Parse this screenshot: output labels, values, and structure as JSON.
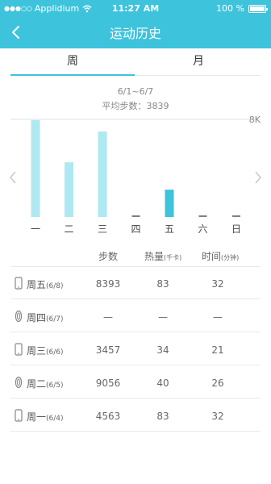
{
  "status": {
    "carrier": "Applidium",
    "time": "11:27 AM",
    "battery": "100 %"
  },
  "nav": {
    "title": "运动历史"
  },
  "tabs": [
    {
      "label": "周",
      "active": true
    },
    {
      "label": "月",
      "active": false
    }
  ],
  "summary": {
    "range": "6/1~6/7",
    "avg": "平均步数：3839"
  },
  "colors": {
    "accent": "#3ec3dc",
    "bar": "#aee8f3",
    "bar_active": "#3ec3dc"
  },
  "chart_data": {
    "type": "bar",
    "categories": [
      "一",
      "二",
      "三",
      "四",
      "五",
      "六",
      "日"
    ],
    "values": [
      8500,
      4800,
      7500,
      0,
      2400,
      0,
      0
    ],
    "highlight_index": 4,
    "ylim": [
      0,
      8000
    ],
    "ymax_label": "8K"
  },
  "table": {
    "headers": {
      "steps": "步数",
      "calories": "热量",
      "calories_unit": "(千卡)",
      "time": "时间",
      "time_unit": "(分钟)"
    },
    "rows": [
      {
        "icon": "phone-icon",
        "day": "周五",
        "date": "(6/8)",
        "steps": "8393",
        "calories": "83",
        "time": "32"
      },
      {
        "icon": "band-icon",
        "day": "周四",
        "date": "(6/7)",
        "steps": "—",
        "calories": "—",
        "time": "—"
      },
      {
        "icon": "phone-icon",
        "day": "周三",
        "date": "(6/6)",
        "steps": "3457",
        "calories": "34",
        "time": "21"
      },
      {
        "icon": "band-icon",
        "day": "周二",
        "date": "(6/5)",
        "steps": "9056",
        "calories": "40",
        "time": "26"
      },
      {
        "icon": "phone-icon",
        "day": "周一",
        "date": "(6/4)",
        "steps": "4563",
        "calories": "83",
        "time": "32"
      }
    ]
  }
}
